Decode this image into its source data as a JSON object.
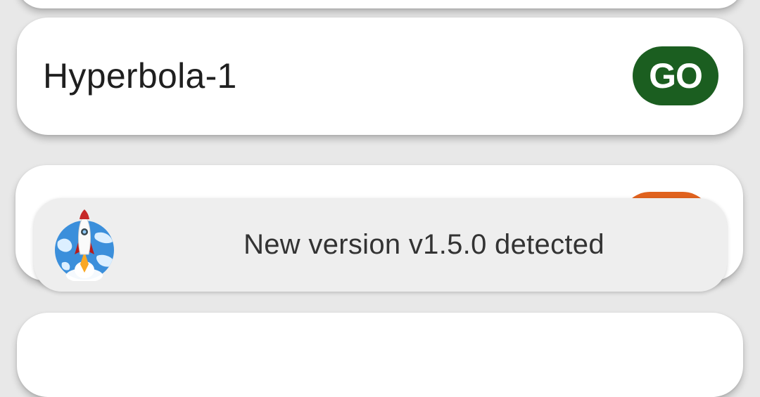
{
  "cards": [
    {
      "title": "Hyperbola-1",
      "button_label": "GO",
      "button_color": "#1b5e20"
    },
    {
      "button_color": "#e0621e"
    }
  ],
  "toast": {
    "message": "New version v1.5.0 detected",
    "icon": "rocket-globe-icon"
  },
  "colors": {
    "background": "#e8e8e8",
    "card": "#ffffff",
    "toast": "#eeeeee"
  }
}
